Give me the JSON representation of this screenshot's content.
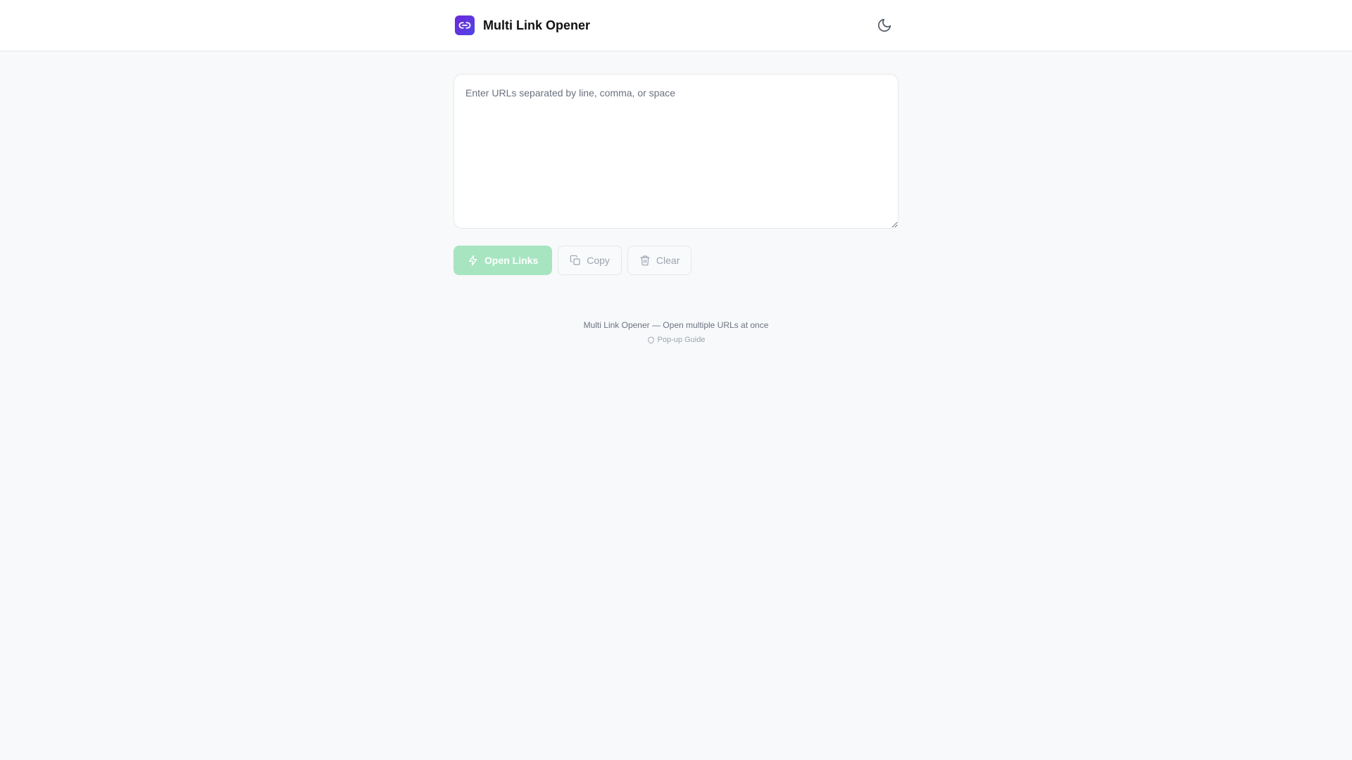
{
  "header": {
    "title": "Multi Link Opener",
    "logo_icon": "link-icon",
    "theme_toggle_icon": "moon-icon"
  },
  "input": {
    "placeholder": "Enter URLs separated by line, comma, or space",
    "value": ""
  },
  "actions": {
    "open_label": "Open Links",
    "open_icon": "lightning-icon",
    "copy_label": "Copy",
    "copy_icon": "copy-icon",
    "clear_label": "Clear",
    "clear_icon": "trash-icon"
  },
  "footer": {
    "tagline": "Multi Link Opener — Open multiple URLs at once",
    "guide_label": "Pop-up Guide",
    "guide_icon": "shield-icon"
  },
  "colors": {
    "brand": "#6d28d9",
    "primary_button": "#a7e5c1",
    "background": "#f8f9fb"
  }
}
